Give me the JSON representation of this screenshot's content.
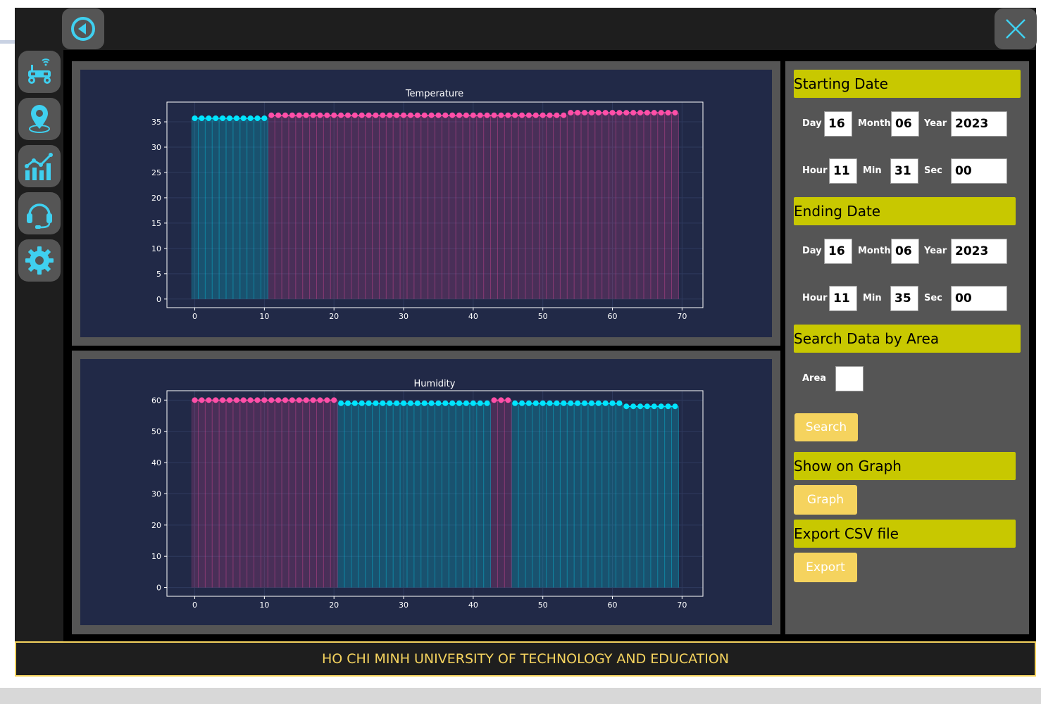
{
  "window": {
    "back_icon": "back-arrow-icon",
    "close_icon": "close-x-icon"
  },
  "sidebar": {
    "items": [
      {
        "icon": "robot-car-wifi-icon"
      },
      {
        "icon": "location-pin-icon"
      },
      {
        "icon": "chart-analytics-icon"
      },
      {
        "icon": "headset-support-icon"
      },
      {
        "icon": "gear-settings-icon"
      }
    ]
  },
  "panel": {
    "starting_date": {
      "heading": "Starting Date",
      "day_label": "Day",
      "day": "16",
      "month_label": "Month",
      "month": "06",
      "year_label": "Year",
      "year": "2023",
      "hour_label": "Hour",
      "hour": "11",
      "min_label": "Min",
      "min": "31",
      "sec_label": "Sec",
      "sec": "00"
    },
    "ending_date": {
      "heading": "Ending Date",
      "day_label": "Day",
      "day": "16",
      "month_label": "Month",
      "month": "06",
      "year_label": "Year",
      "year": "2023",
      "hour_label": "Hour",
      "hour": "11",
      "min_label": "Min",
      "min": "35",
      "sec_label": "Sec",
      "sec": "00"
    },
    "search_area": {
      "heading": "Search Data by Area",
      "area_label": "Area",
      "area_value": "",
      "search_button": "Search"
    },
    "graph": {
      "heading": "Show on Graph",
      "button": "Graph"
    },
    "export": {
      "heading": "Export CSV file",
      "button": "Export"
    }
  },
  "footer": {
    "text": "HO CHI MINH UNIVERSITY OF TECHNOLOGY AND EDUCATION"
  },
  "colors": {
    "accent_yellow_bar": "#c8c800",
    "button_yellow": "#f5d35e",
    "cyan": "#00e5ff",
    "pink": "#ff4fa8",
    "plot_bg": "#212947"
  },
  "chart_data": [
    {
      "type": "bar",
      "title": "Temperature",
      "xlabel": "",
      "ylabel": "",
      "xlim": [
        -4,
        73
      ],
      "ylim": [
        -1.7,
        38.9
      ],
      "xticks": [
        0,
        10,
        20,
        30,
        40,
        50,
        60,
        70
      ],
      "yticks": [
        0,
        5,
        10,
        15,
        20,
        25,
        30,
        35
      ],
      "grid": true,
      "segments": [
        {
          "from": 0,
          "to": 10,
          "value": 35.7,
          "color": "cyan"
        },
        {
          "from": 11,
          "to": 53,
          "value": 36.3,
          "color": "pink"
        },
        {
          "from": 54,
          "to": 69,
          "value": 36.8,
          "color": "pink"
        }
      ]
    },
    {
      "type": "bar",
      "title": "Humidity",
      "xlabel": "",
      "ylabel": "",
      "xlim": [
        -4,
        73
      ],
      "ylim": [
        -2.8,
        63
      ],
      "xticks": [
        0,
        10,
        20,
        30,
        40,
        50,
        60,
        70
      ],
      "yticks": [
        0,
        10,
        20,
        30,
        40,
        50,
        60
      ],
      "grid": true,
      "segments": [
        {
          "from": 0,
          "to": 20,
          "value": 60,
          "color": "pink"
        },
        {
          "from": 21,
          "to": 42,
          "value": 59,
          "color": "cyan"
        },
        {
          "from": 43,
          "to": 45,
          "value": 60,
          "color": "pink"
        },
        {
          "from": 46,
          "to": 61,
          "value": 59,
          "color": "cyan"
        },
        {
          "from": 62,
          "to": 69,
          "value": 58,
          "color": "cyan"
        }
      ]
    }
  ]
}
